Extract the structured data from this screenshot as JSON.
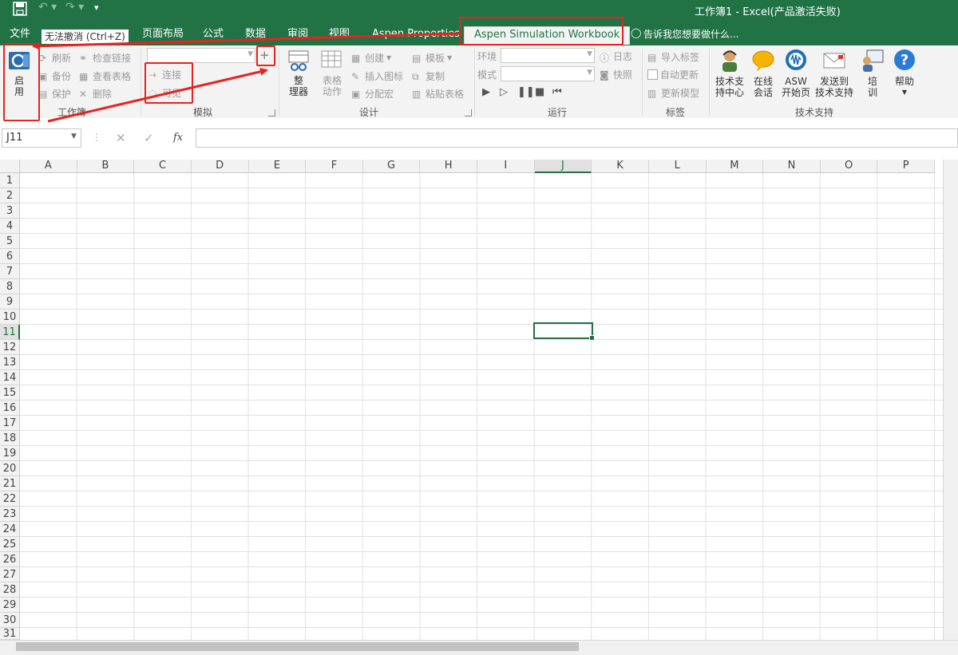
{
  "window": {
    "title": "工作簿1 - Excel(产品激活失败)"
  },
  "tabs": [
    {
      "label": "文件"
    },
    {
      "label": "无法撤消 (Ctrl+Z)"
    },
    {
      "label": "页面布局"
    },
    {
      "label": "公式"
    },
    {
      "label": "数据"
    },
    {
      "label": "审阅"
    },
    {
      "label": "视图"
    },
    {
      "label": "Aspen Properties"
    },
    {
      "label": "Aspen Simulation Workbook"
    }
  ],
  "tell_me": "告诉我您想要做什么...",
  "ribbon": {
    "workbook": {
      "label": "工作簿",
      "enable": "启\n用",
      "refresh": "刷新",
      "backup": "备份",
      "protect": "保护",
      "check_links": "检查链接",
      "view_table": "查看表格",
      "delete": "删除"
    },
    "simulation": {
      "label": "模拟",
      "connect": "连接",
      "visible": "可见"
    },
    "design": {
      "label": "设计",
      "organizer": "整\n理器",
      "table_action": "表格\n动作",
      "create": "创建",
      "insert_icon": "插入图标",
      "assign_macro": "分配宏",
      "template": "模板",
      "copy": "复制",
      "paste_table": "粘贴表格"
    },
    "run": {
      "label": "运行",
      "env": "环境",
      "mode": "模式",
      "log": "日志",
      "snapshot": "快照"
    },
    "tags": {
      "label": "标签",
      "import": "导入标签",
      "auto_update": "自动更新",
      "update_model": "更新模型"
    },
    "support": {
      "label": "技术支持",
      "center": "技术支\n持中心",
      "chat": "在线\n会话",
      "asw_start": "ASW\n开始页",
      "send": "发送到\n技术支持",
      "training": "培\n训",
      "help": "帮助"
    }
  },
  "formula_bar": {
    "name_box": "J11",
    "fx": "fx"
  },
  "grid": {
    "columns": [
      "A",
      "B",
      "C",
      "D",
      "E",
      "F",
      "G",
      "H",
      "I",
      "J",
      "K",
      "L",
      "M",
      "N",
      "O",
      "P"
    ],
    "rows": [
      "1",
      "2",
      "3",
      "4",
      "5",
      "6",
      "7",
      "8",
      "9",
      "10",
      "11",
      "12",
      "13",
      "14",
      "15",
      "16",
      "17",
      "18",
      "19",
      "20",
      "21",
      "22",
      "23",
      "24",
      "25",
      "26",
      "27",
      "28",
      "29",
      "30",
      "31"
    ],
    "selected_column": "J",
    "selected_row": "11"
  },
  "colors": {
    "excel_green": "#217346",
    "annotation_red": "#e8231f"
  }
}
